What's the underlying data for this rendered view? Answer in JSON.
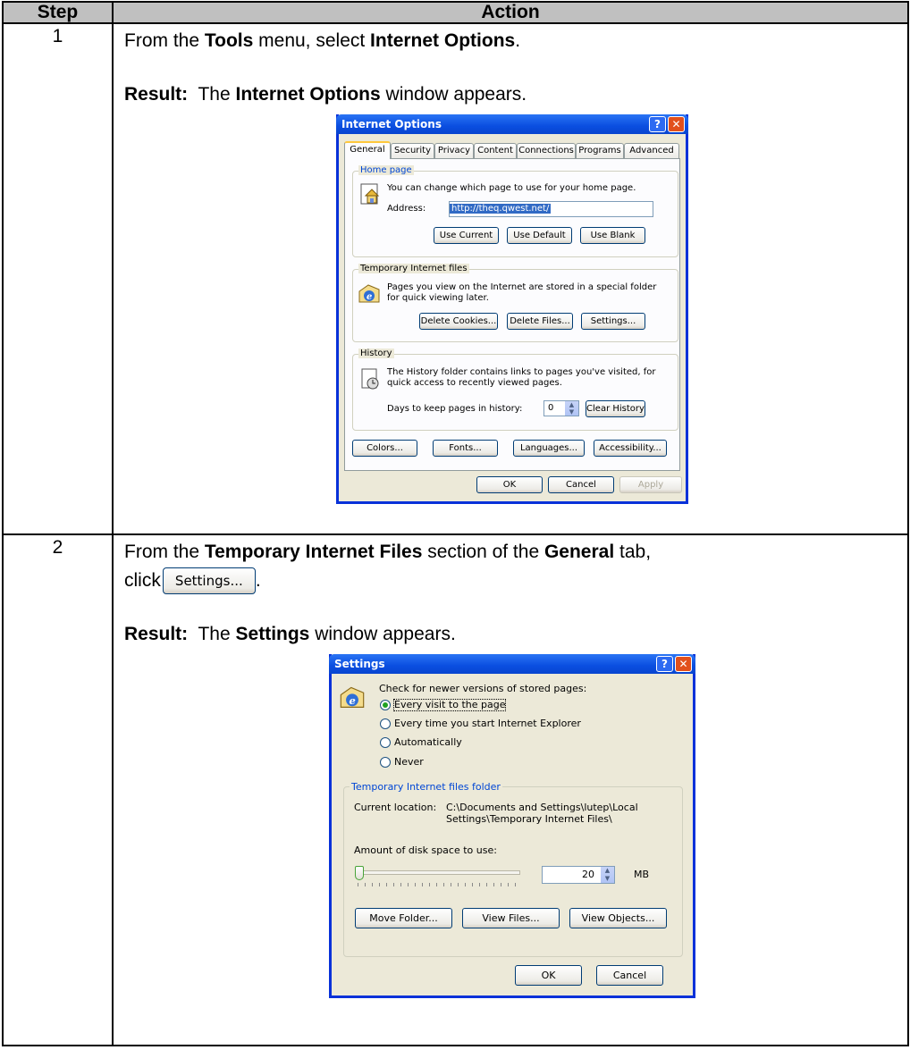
{
  "table": {
    "header_step": "Step",
    "header_action": "Action"
  },
  "row1": {
    "step": "1",
    "line1": [
      "From the ",
      "Tools",
      " menu, select ",
      "Internet Options",
      "."
    ],
    "result_label": "Result:",
    "result_text": [
      "The ",
      "Internet Options",
      " window appears."
    ]
  },
  "io": {
    "title": "Internet Options",
    "tabs": [
      "General",
      "Security",
      "Privacy",
      "Content",
      "Connections",
      "Programs",
      "Advanced"
    ],
    "home_legend": "Home page",
    "home_text": "You can change which page to use for your home page.",
    "address_label": "Address:",
    "address_value": "http://theq.qwest.net/",
    "btn_use_current": "Use Current",
    "btn_use_default": "Use Default",
    "btn_use_blank": "Use Blank",
    "temp_legend": "Temporary Internet files",
    "temp_text1": "Pages you view on the Internet are stored in a special folder",
    "temp_text2": "for quick viewing later.",
    "btn_delete_cookies": "Delete Cookies...",
    "btn_delete_files": "Delete Files...",
    "btn_settings": "Settings...",
    "history_legend": "History",
    "history_text1": "The History folder contains links to pages you've visited, for",
    "history_text2": "quick access to recently viewed pages.",
    "days_label": "Days to keep pages in history:",
    "days_value": "0",
    "btn_clear_history": "Clear History",
    "btn_colors": "Colors...",
    "btn_fonts": "Fonts...",
    "btn_languages": "Languages...",
    "btn_accessibility": "Accessibility...",
    "btn_ok": "OK",
    "btn_cancel": "Cancel",
    "btn_apply": "Apply"
  },
  "row2": {
    "step": "2",
    "line1": [
      "From the ",
      "Temporary Internet Files",
      " section of the ",
      "General",
      " tab,"
    ],
    "click_word": "click",
    "click_btn": "Settings...",
    "period": ".",
    "result_label": "Result:",
    "result_text": [
      "The ",
      "Settings",
      " window appears."
    ]
  },
  "st": {
    "title": "Settings",
    "check_label": "Check for newer versions of stored pages:",
    "radio1": "Every visit to the page",
    "radio2": "Every time you start Internet Explorer",
    "radio3": "Automatically",
    "radio4": "Never",
    "folder_legend": "Temporary Internet files folder",
    "current_location_label": "Current location:",
    "current_location_line1": "C:\\Documents and Settings\\lutep\\Local",
    "current_location_line2": "Settings\\Temporary Internet Files\\",
    "disk_label": "Amount of disk space to use:",
    "disk_value": "20",
    "disk_unit": "MB",
    "btn_move_folder": "Move Folder...",
    "btn_view_files": "View Files...",
    "btn_view_objects": "View Objects...",
    "btn_ok": "OK",
    "btn_cancel": "Cancel"
  }
}
